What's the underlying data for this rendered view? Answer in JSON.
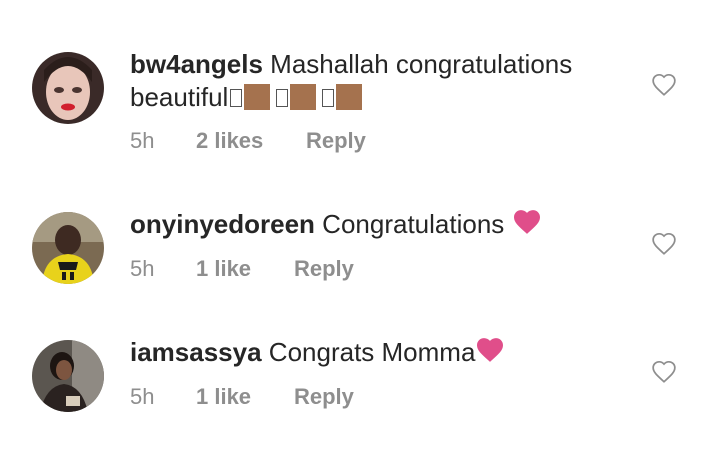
{
  "comments": [
    {
      "username": "bw4angels",
      "text_part1": "Mashallah congratulations",
      "text_part2": "beautiful",
      "time": "5h",
      "likes": "2 likes",
      "reply": "Reply",
      "avatar_icon": "user-avatar-photo",
      "text_emoji": [
        "unsupported-glyph",
        "brown-skin-tone-square",
        "unsupported-glyph",
        "brown-skin-tone-square",
        "unsupported-glyph",
        "brown-skin-tone-square"
      ]
    },
    {
      "username": "onyinyedoreen",
      "text": "Congratulations",
      "time": "5h",
      "likes": "1 like",
      "reply": "Reply",
      "avatar_icon": "user-avatar-photo",
      "text_emoji": [
        "pink-heart-emoji"
      ]
    },
    {
      "username": "iamsassya",
      "text": "Congrats Momma",
      "time": "5h",
      "likes": "1 like",
      "reply": "Reply",
      "avatar_icon": "user-avatar-photo",
      "text_emoji": [
        "pink-heart-emoji"
      ]
    }
  ],
  "like_icon": "heart-outline-icon",
  "colors": {
    "text": "#262626",
    "meta": "#8e8e8e",
    "heart_emoji": "#e04e8a",
    "skin_tone": "#a5724e"
  }
}
